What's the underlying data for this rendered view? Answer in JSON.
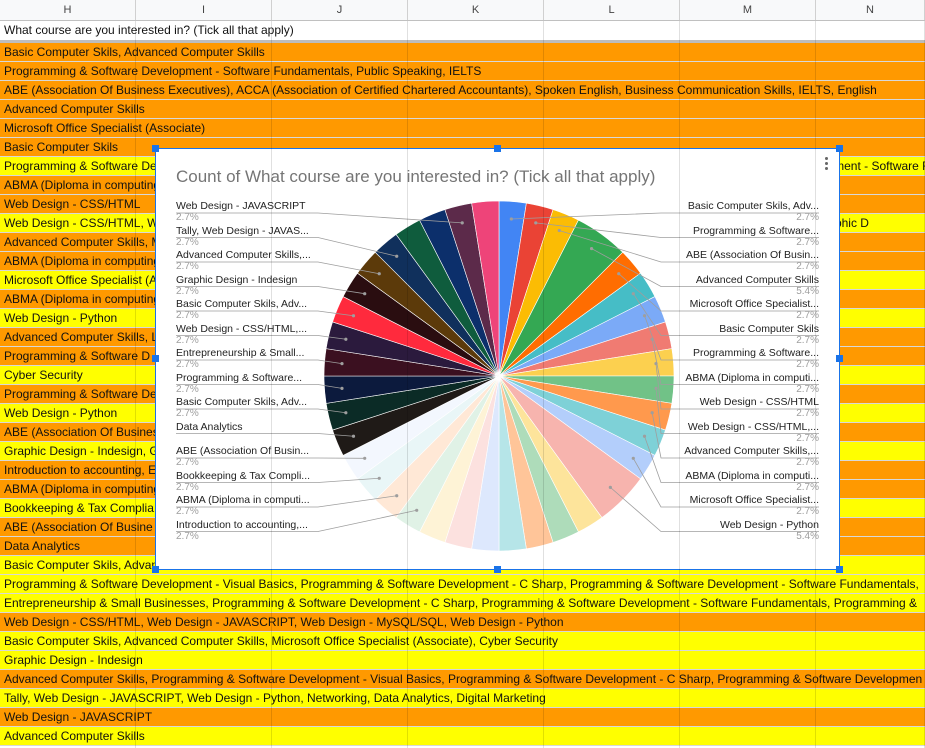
{
  "columns": [
    "H",
    "I",
    "J",
    "K",
    "L",
    "M",
    "N"
  ],
  "header_text": "What course are you interested in? (Tick all that apply)",
  "rows": [
    {
      "text": "Basic Computer Skils, Advanced Computer Skills",
      "color": "#ff9900"
    },
    {
      "text": "Programming & Software Development - Software Fundamentals, Public Speaking, IELTS",
      "color": "#ff9900"
    },
    {
      "text": "ABE (Association Of Business Executives), ACCA (Association of Certified Chartered Accountants), Spoken English, Business Communication Skills, IELTS, English",
      "color": "#ff9900"
    },
    {
      "text": "Advanced Computer Skills",
      "color": "#ff9900"
    },
    {
      "text": "Microsoft Office Specialist (Associate)",
      "color": "#ff9900"
    },
    {
      "text": "Basic Computer Skils",
      "color": "#ff9900"
    },
    {
      "text": "Programming & Software Development - Software Fundamentals, Programming & Software Development - Visual Basics, Programming & Software Development - Software Fundamentals,",
      "color": "#ffff00"
    },
    {
      "text": "ABMA (Diploma in computing",
      "color": "#ff9900"
    },
    {
      "text": "Web Design - CSS/HTML",
      "color": "#ff9900"
    },
    {
      "text": "Web Design - CSS/HTML, Web Design - JAVASCRIPT, Web Design - Python, Web Design - MySQL/SQL, Digital Marketing, Graphic Design - Illustrator, Graphic D",
      "color": "#ffff00"
    },
    {
      "text": "Advanced Computer Skills, M",
      "color": "#ff9900"
    },
    {
      "text": "ABMA (Diploma in computing), Programming & Software Development - Visual Basics, Programming & Software Development - C Sharp, Program",
      "color": "#ff9900"
    },
    {
      "text": "Microsoft Office Specialist (A",
      "color": "#ffff00"
    },
    {
      "text": "ABMA (Diploma in computing",
      "color": "#ff9900"
    },
    {
      "text": "Web Design - Python",
      "color": "#ffff00"
    },
    {
      "text": "Advanced Computer Skills, L",
      "color": "#ff9900"
    },
    {
      "text": "Programming & Software D",
      "color": "#ff9900"
    },
    {
      "text": "Cyber Security",
      "color": "#ffff00"
    },
    {
      "text": "Programming & Software Development - Visual Basics, Programming & Software Development - Software Fundamentals,",
      "color": "#ff9900"
    },
    {
      "text": "Web Design - Python",
      "color": "#ffff00"
    },
    {
      "text": "ABE (Association Of Business Executives), ACCA, Programming & Software Development - Software Fundamentals, Introduction to a",
      "color": "#ff9900"
    },
    {
      "text": "Graphic Design - Indesign, G",
      "color": "#ffff00"
    },
    {
      "text": "Introduction to accounting, E",
      "color": "#ff9900"
    },
    {
      "text": "ABMA (Diploma in computing",
      "color": "#ff9900"
    },
    {
      "text": "Bookkeeping & Tax Complia, Programming & Software Development - Visual Basics, Programming & Software Development - C Sharp, Programming & S",
      "color": "#ffff00"
    },
    {
      "text": "ABE (Association Of Busine",
      "color": "#ff9900"
    },
    {
      "text": "Data Analytics",
      "color": "#ff9900"
    },
    {
      "text": "Basic Computer Skils, Advan",
      "color": "#ffff00"
    },
    {
      "text": "Programming & Software Development - Visual Basics, Programming & Software Development - C Sharp, Programming & Software Development - Software Fundamentals,",
      "color": "#ffff00"
    },
    {
      "text": "Entrepreneurship & Small Businesses, Programming & Software Development - C Sharp, Programming & Software Development - Software Fundamentals, Programming &",
      "color": "#ffff00"
    },
    {
      "text": "Web Design - CSS/HTML, Web Design - JAVASCRIPT, Web Design - MySQL/SQL, Web Design - Python",
      "color": "#ff9900"
    },
    {
      "text": "Basic Computer Skils, Advanced Computer Skills, Microsoft Office Specialist (Associate), Cyber Security",
      "color": "#ffff00"
    },
    {
      "text": "Graphic Design - Indesign",
      "color": "#ffff00"
    },
    {
      "text": "Advanced Computer Skills, Programming & Software Development - Visual Basics, Programming & Software Development - C Sharp, Programming & Software Developmen",
      "color": "#ff9900"
    },
    {
      "text": "Tally, Web Design - JAVASCRIPT, Web Design - Python, Networking, Data Analytics, Digital Marketing",
      "color": "#ffff00"
    },
    {
      "text": "Web Design - JAVASCRIPT",
      "color": "#ff9900"
    },
    {
      "text": "Advanced Computer Skills",
      "color": "#ffff00"
    }
  ],
  "chart_data": {
    "type": "pie",
    "title": "Count of What course are you interested in? (Tick all that apply)",
    "legend": "labels-with-leaders",
    "slices": [
      {
        "label": "Basic Computer Skils, Adv...",
        "pct": "2.7%",
        "value": 2.7,
        "color": "#4285f4"
      },
      {
        "label": "Programming & Software...",
        "pct": "2.7%",
        "value": 2.7,
        "color": "#ea4335"
      },
      {
        "label": "ABE (Association Of Busin...",
        "pct": "2.7%",
        "value": 2.7,
        "color": "#fbbc04"
      },
      {
        "label": "Advanced Computer Skills",
        "pct": "5.4%",
        "value": 5.4,
        "color": "#34a853"
      },
      {
        "label": "Microsoft Office Specialist...",
        "pct": "2.7%",
        "value": 2.7,
        "color": "#ff6d01"
      },
      {
        "label": "Basic Computer Skils",
        "pct": "2.7%",
        "value": 2.7,
        "color": "#46bdc6"
      },
      {
        "label": "Programming & Software...",
        "pct": "2.7%",
        "value": 2.7,
        "color": "#7baaf7"
      },
      {
        "label": "ABMA (Diploma in computi...",
        "pct": "2.7%",
        "value": 2.7,
        "color": "#f07b72"
      },
      {
        "label": "Web Design - CSS/HTML",
        "pct": "2.7%",
        "value": 2.7,
        "color": "#fcd04f"
      },
      {
        "label": "Web Design - CSS/HTML,...",
        "pct": "2.7%",
        "value": 2.7,
        "color": "#71c287"
      },
      {
        "label": "Advanced Computer Skills,...",
        "pct": "2.7%",
        "value": 2.7,
        "color": "#ff994d"
      },
      {
        "label": "ABMA (Diploma in computi...",
        "pct": "2.7%",
        "value": 2.7,
        "color": "#7ed1d7"
      },
      {
        "label": "Microsoft Office Specialist...",
        "pct": "2.7%",
        "value": 2.7,
        "color": "#b3cefb"
      },
      {
        "label": "Web Design - Python",
        "pct": "5.4%",
        "value": 5.4,
        "color": "#f7b4ae"
      },
      {
        "label": "",
        "pct": "",
        "value": 2.7,
        "color": "#fde49b"
      },
      {
        "label": "",
        "pct": "",
        "value": 2.7,
        "color": "#aedcba"
      },
      {
        "label": "",
        "pct": "",
        "value": 2.7,
        "color": "#ffc599"
      },
      {
        "label": "",
        "pct": "",
        "value": 2.7,
        "color": "#b6e5e8"
      },
      {
        "label": "",
        "pct": "",
        "value": 2.7,
        "color": "#dde8fd"
      },
      {
        "label": "",
        "pct": "",
        "value": 2.7,
        "color": "#fce1df"
      },
      {
        "label": "",
        "pct": "",
        "value": 2.7,
        "color": "#fef3d6"
      },
      {
        "label": "Introduction to accounting,...",
        "pct": "2.7%",
        "value": 2.7,
        "color": "#e0f2e6"
      },
      {
        "label": "ABMA (Diploma in computi...",
        "pct": "2.7%",
        "value": 2.7,
        "color": "#ffe8d6"
      },
      {
        "label": "Bookkeeping & Tax Compli...",
        "pct": "2.7%",
        "value": 2.7,
        "color": "#e9f6f7"
      },
      {
        "label": "ABE (Association Of Busin...",
        "pct": "2.7%",
        "value": 2.7,
        "color": "#f3f7fe"
      },
      {
        "label": "Data Analytics",
        "pct": "",
        "value": 2.7,
        "color": "#1f1a17"
      },
      {
        "label": "Basic Computer Skils, Adv...",
        "pct": "2.7%",
        "value": 2.7,
        "color": "#0b2b26"
      },
      {
        "label": "Programming & Software...",
        "pct": "2.7%",
        "value": 2.7,
        "color": "#0c1a3d"
      },
      {
        "label": "Entrepreneurship & Small...",
        "pct": "2.7%",
        "value": 2.7,
        "color": "#3b1020"
      },
      {
        "label": "Web Design - CSS/HTML,...",
        "pct": "2.7%",
        "value": 2.7,
        "color": "#2b1a3d"
      },
      {
        "label": "Basic Computer Skils, Adv...",
        "pct": "2.7%",
        "value": 2.7,
        "color": "#ff2a3d"
      },
      {
        "label": "Graphic Design - Indesign",
        "pct": "2.7%",
        "value": 2.7,
        "color": "#2a0d10"
      },
      {
        "label": "Advanced Computer Skills,...",
        "pct": "2.7%",
        "value": 2.7,
        "color": "#5c3a0a"
      },
      {
        "label": "Tally, Web Design - JAVAS...",
        "pct": "2.7%",
        "value": 2.7,
        "color": "#10305c"
      },
      {
        "label": "",
        "pct": "",
        "value": 2.7,
        "color": "#0f5c3d"
      },
      {
        "label": "",
        "pct": "",
        "value": 2.7,
        "color": "#0c2f6b"
      },
      {
        "label": "Web Design - JAVASCRIPT",
        "pct": "2.7%",
        "value": 2.7,
        "color": "#5c2a4a"
      },
      {
        "label": "",
        "pct": "",
        "value": 2.7,
        "color": "#ee4479"
      }
    ]
  }
}
